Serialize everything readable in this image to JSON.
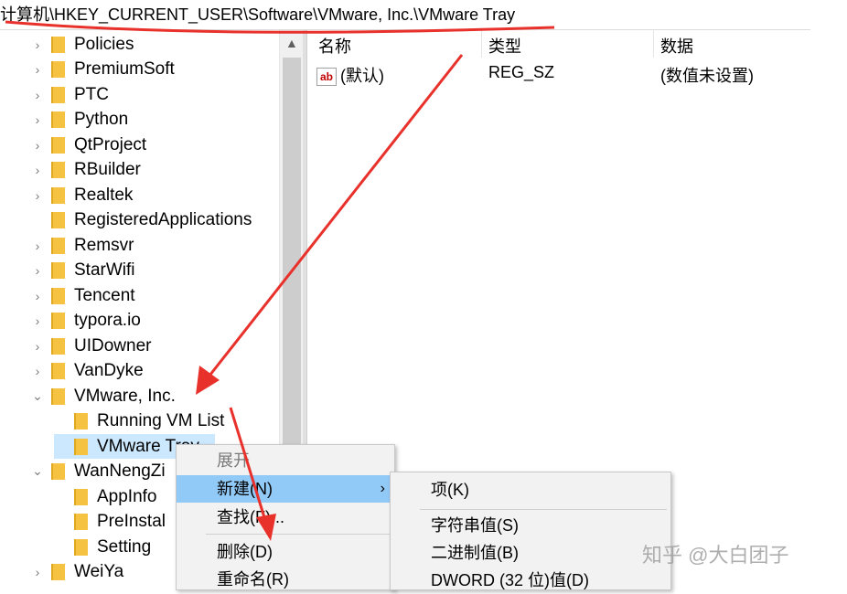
{
  "address_bar": {
    "path": "计算机\\HKEY_CURRENT_USER\\Software\\VMware, Inc.\\VMware Tray"
  },
  "tree": {
    "items": [
      {
        "label": "Policies",
        "expander": "›"
      },
      {
        "label": "PremiumSoft",
        "expander": "›"
      },
      {
        "label": "PTC",
        "expander": "›"
      },
      {
        "label": "Python",
        "expander": "›"
      },
      {
        "label": "QtProject",
        "expander": "›"
      },
      {
        "label": "RBuilder",
        "expander": "›"
      },
      {
        "label": "Realtek",
        "expander": "›"
      },
      {
        "label": "RegisteredApplications",
        "expander": ""
      },
      {
        "label": "Remsvr",
        "expander": "›"
      },
      {
        "label": "StarWifi",
        "expander": "›"
      },
      {
        "label": "Tencent",
        "expander": "›"
      },
      {
        "label": "typora.io",
        "expander": "›"
      },
      {
        "label": "UIDowner",
        "expander": "›"
      },
      {
        "label": "VanDyke",
        "expander": "›"
      },
      {
        "label": "VMware, Inc.",
        "expander": "⌄"
      },
      {
        "label": "Running VM List",
        "expander": ""
      },
      {
        "label": "VMware Tray",
        "expander": "",
        "selected": true
      },
      {
        "label": "WanNengZi",
        "expander": "⌄"
      },
      {
        "label": "AppInfo",
        "expander": ""
      },
      {
        "label": "PreInstal",
        "expander": ""
      },
      {
        "label": "Setting",
        "expander": ""
      },
      {
        "label": "WeiYa",
        "expander": "›"
      }
    ]
  },
  "list": {
    "headers": {
      "name": "名称",
      "type": "类型",
      "data": "数据"
    },
    "rows": [
      {
        "icon": "ab",
        "name": "(默认)",
        "type": "REG_SZ",
        "data": "(数值未设置)"
      }
    ]
  },
  "context_menu": {
    "items": [
      {
        "label": "展开",
        "disabled": true
      },
      {
        "label": "新建(N)",
        "highlighted": true,
        "submenu_arrow": "›"
      },
      {
        "label": "查找(F)..."
      },
      {
        "label": "删除(D)"
      },
      {
        "label": "重命名(R)"
      }
    ]
  },
  "submenu": {
    "items": [
      {
        "label": "项(K)"
      },
      {
        "label": "字符串值(S)"
      },
      {
        "label": "二进制值(B)"
      },
      {
        "label": "DWORD (32 位)值(D)"
      }
    ]
  },
  "watermark": "知乎 @大白团子",
  "colors": {
    "annotation_red": "#e8312b",
    "selection": "#cce8ff",
    "menu_highlight": "#91c9f7",
    "folder": "#f5c242"
  }
}
